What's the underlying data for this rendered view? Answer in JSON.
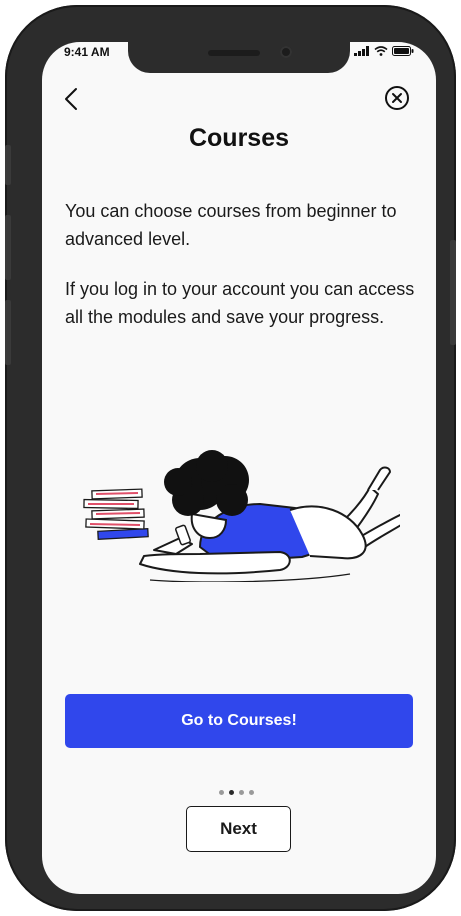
{
  "status_bar": {
    "time": "9:41 AM",
    "icons": [
      "signal-icon",
      "wifi-icon",
      "battery-icon"
    ]
  },
  "header": {
    "back_icon": "chevron-left-icon",
    "close_icon": "close-circle-icon",
    "title": "Courses"
  },
  "content": {
    "paragraph_1": "You can choose courses from beginner to advanced level.",
    "paragraph_2": "If you log in to your account you can access all the modules and save your progress."
  },
  "actions": {
    "primary_label": "Go to Courses!",
    "next_label": "Next"
  },
  "pager": {
    "total": 4,
    "active_index": 1
  },
  "colors": {
    "accent": "#3047ec",
    "background": "#f9f9f9",
    "frame": "#2c2c2c"
  }
}
